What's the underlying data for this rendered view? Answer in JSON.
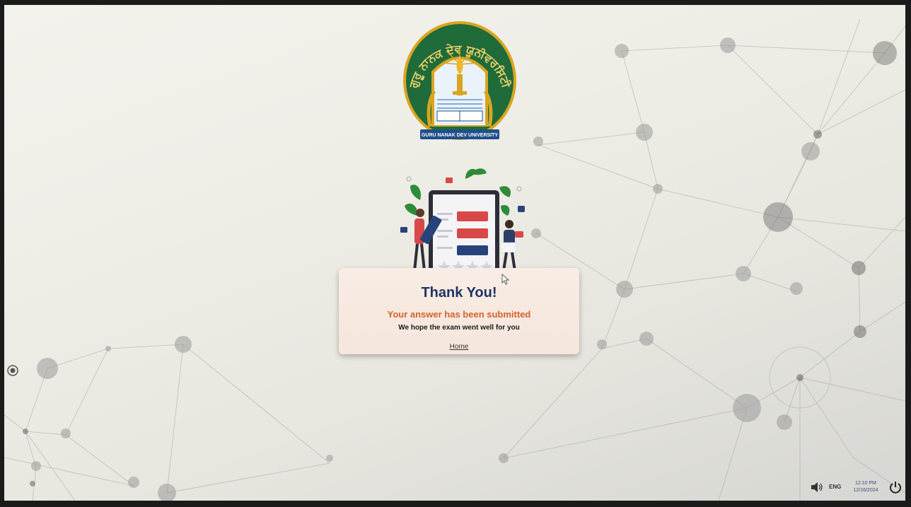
{
  "logo": {
    "arc_text": "ਗੁਰੂ ਨਾਨਕ ਦੇਵ ਯੂਨੀਵਰਸਿਟੀ",
    "banner_text": "GURU NANAK DEV UNIVERSITY"
  },
  "illustration": {
    "icon": "feedback-illustration"
  },
  "dialog": {
    "title": "Thank You!",
    "subtitle": "Your answer has been submitted",
    "message": "We hope the exam went well for you",
    "home_link": "Home"
  },
  "taskbar": {
    "language": "ENG",
    "time": "12:10 PM",
    "date": "12/16/2024"
  },
  "colors": {
    "title": "#1f3464",
    "subtitle": "#d2622c",
    "dialog_bg": "#f7e9df",
    "logo_green": "#1f6b3a",
    "logo_blue": "#1e4f8a",
    "logo_gold": "#d9a521"
  }
}
